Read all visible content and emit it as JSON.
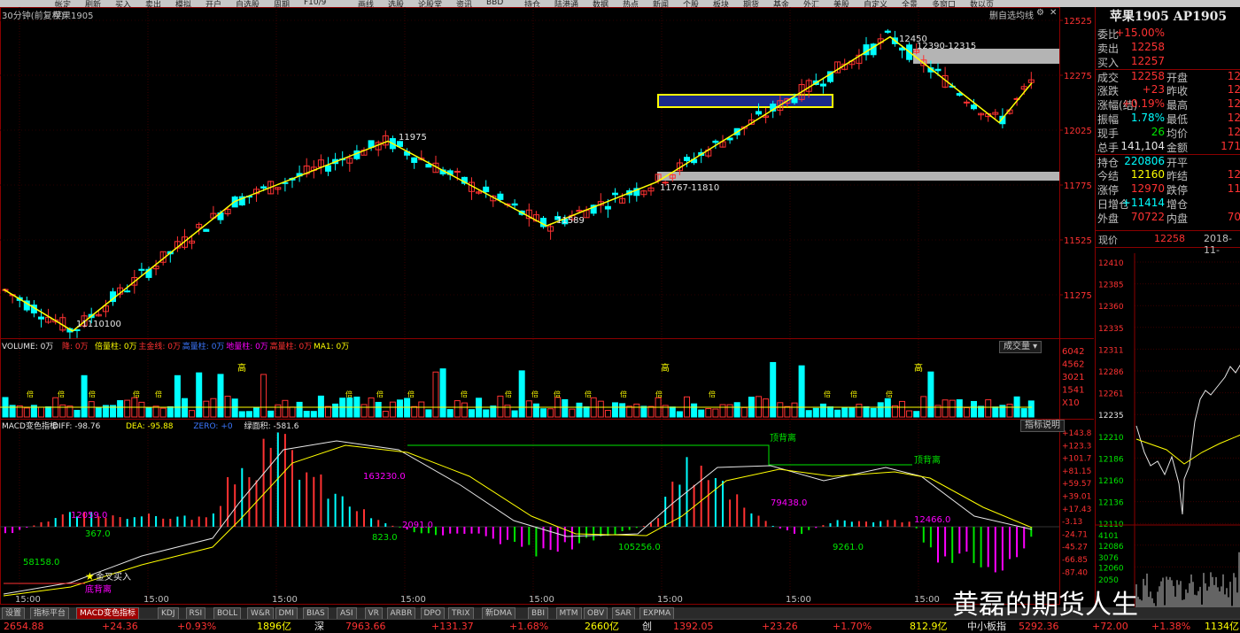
{
  "toolbar": {
    "items": [
      "帐定",
      "刷新",
      "买入",
      "卖出",
      "模拟",
      "开户",
      "自选股",
      "周期",
      "F10/9",
      "画线",
      "选股",
      "论股堂",
      "资讯",
      "BBD",
      "持仓",
      "陆港通",
      "数据",
      "热点",
      "新闻",
      "个股",
      "板块",
      "期货",
      "基金",
      "外汇",
      "美股",
      "自定义",
      "全景",
      "多窗口",
      "数以页"
    ]
  },
  "chart": {
    "header_left": "30分钟(前复权)",
    "symbol_name": "苹果1905",
    "header_right_items": [
      "删自选",
      "均线",
      "⚙",
      "✕"
    ],
    "price_ticks": [
      "12525",
      "12275",
      "12025",
      "11775",
      "11525",
      "11275"
    ],
    "annotations": [
      "12450",
      "12390-12315",
      "11975",
      "11767-11810",
      "11589",
      "11110100"
    ],
    "time_labels": [
      "15:00",
      "15:00",
      "15:00",
      "15:00",
      "15:00",
      "15:00",
      "15:00",
      "15:00"
    ]
  },
  "volume": {
    "legend": [
      "VOLUME: 0万",
      "降: 0万",
      "倍量柱: 0万",
      "主金线: 0万",
      "高量柱: 0万",
      "地量柱: 0万",
      "高量柱: 0万",
      "MA1: 0万"
    ],
    "legend_colors": [
      "#e6e6e6",
      "#ff3232",
      "#ffff00",
      "#ff3232",
      "#3c78ff",
      "#ff00ff",
      "#ff3232",
      "#ffff00"
    ],
    "dropdown_label": "成交量",
    "y_ticks": [
      "6042",
      "4562",
      "3021",
      "1541",
      "X10"
    ],
    "marker_high": "高",
    "marker_double": "倍"
  },
  "macd": {
    "legend": [
      "MACD变色指标",
      "DIFF: -98.76",
      "DEA: -95.88",
      "ZERO: +0",
      "绿面积: -581.6"
    ],
    "legend_colors": [
      "#e6e6e6",
      "#e6e6e6",
      "#ffff00",
      "#3c78ff",
      "#e6e6e6"
    ],
    "help_label": "指标说明",
    "y_ticks": [
      "+143.8",
      "+123.3",
      "+101.7",
      "+81.15",
      "+59.57",
      "+39.01",
      "+17.43",
      "-3.13",
      "-24.71",
      "-45.27",
      "-66.85",
      "-87.40"
    ],
    "labels": [
      "12059.0",
      "367.0",
      "58158.0",
      "163230.0",
      "823.0",
      "2091.0",
      "105256.0",
      "79438.0",
      "9261.0",
      "12466.0",
      "顶背离",
      "顶背离",
      "金叉买入",
      "底背离"
    ]
  },
  "right_panel": {
    "title": "苹果1905 AP1905",
    "rows": [
      {
        "l": "委比",
        "v": "+15.00%",
        "c": "red"
      },
      {
        "l": "卖出",
        "v": "12258",
        "c": "red"
      },
      {
        "l": "买入",
        "v": "12257",
        "c": "red"
      },
      {
        "l": "成交",
        "v": "12258",
        "c": "red",
        "l2": "开盘",
        "v2": "12"
      },
      {
        "l": "涨跌",
        "v": "+23",
        "c": "red",
        "l2": "昨收",
        "v2": "12"
      },
      {
        "l": "涨幅(结)",
        "v": "+0.19%",
        "c": "red",
        "l2": "最高",
        "v2": "12"
      },
      {
        "l": "振幅",
        "v": "1.78%",
        "c": "cyan",
        "l2": "最低",
        "v2": "12"
      },
      {
        "l": "现手",
        "v": "26",
        "c": "green",
        "l2": "均价",
        "v2": "12"
      },
      {
        "l": "总手",
        "v": "141,104",
        "c": "white",
        "l2": "金额",
        "v2": "171"
      },
      {
        "l": "持仓",
        "v": "220806",
        "c": "cyan",
        "l2": "开平",
        "v2": ""
      },
      {
        "l": "今结",
        "v": "12160",
        "c": "yellow",
        "l2": "昨结",
        "v2": "12"
      },
      {
        "l": "涨停",
        "v": "12970",
        "c": "red",
        "l2": "跌停",
        "v2": "11"
      },
      {
        "l": "日增仓",
        "v": "+11414",
        "c": "cyan",
        "l2": "增仓",
        "v2": ""
      },
      {
        "l": "外盘",
        "v": "70722",
        "c": "red",
        "l2": "内盘",
        "v2": "70"
      }
    ],
    "price_label": "现价",
    "price_value": "12258",
    "date": "2018-11-",
    "mini_ticks": [
      "12410",
      "12385",
      "12360",
      "12335",
      "12311",
      "12286",
      "12261",
      "12235",
      "12210",
      "12186",
      "12160",
      "12136",
      "12110",
      "12086",
      "12060"
    ],
    "vol_ticks": [
      "4101",
      "3076",
      "2050"
    ]
  },
  "tabs": [
    "设置",
    "指标平台",
    "MACD变色指标",
    "KDJ",
    "RSI",
    "BOLL",
    "W&R",
    "DMI",
    "BIAS",
    "ASI",
    "VR",
    "ARBR",
    "DPO",
    "TRIX",
    "新DMA",
    "BBI",
    "MTM",
    "OBV",
    "SAR",
    "EXPMA"
  ],
  "status": [
    {
      "t": "2654.88",
      "c": "red"
    },
    {
      "t": "+24.36",
      "c": "red"
    },
    {
      "t": "+0.93%",
      "c": "red"
    },
    {
      "t": "1896亿",
      "c": "yellow"
    },
    {
      "t": "深",
      "c": "white"
    },
    {
      "t": "7963.66",
      "c": "red"
    },
    {
      "t": "+131.37",
      "c": "red"
    },
    {
      "t": "+1.68%",
      "c": "red"
    },
    {
      "t": "2660亿",
      "c": "yellow"
    },
    {
      "t": "创",
      "c": "white"
    },
    {
      "t": "1392.05",
      "c": "red"
    },
    {
      "t": "+23.26",
      "c": "red"
    },
    {
      "t": "+1.70%",
      "c": "red"
    },
    {
      "t": "812.9亿",
      "c": "yellow"
    },
    {
      "t": "中小板指",
      "c": "white"
    },
    {
      "t": "5292.36",
      "c": "red"
    },
    {
      "t": "+72.00",
      "c": "red"
    },
    {
      "t": "+1.38%",
      "c": "red"
    },
    {
      "t": "1134亿",
      "c": "yellow"
    }
  ],
  "watermark": "黄磊的期货人生"
}
